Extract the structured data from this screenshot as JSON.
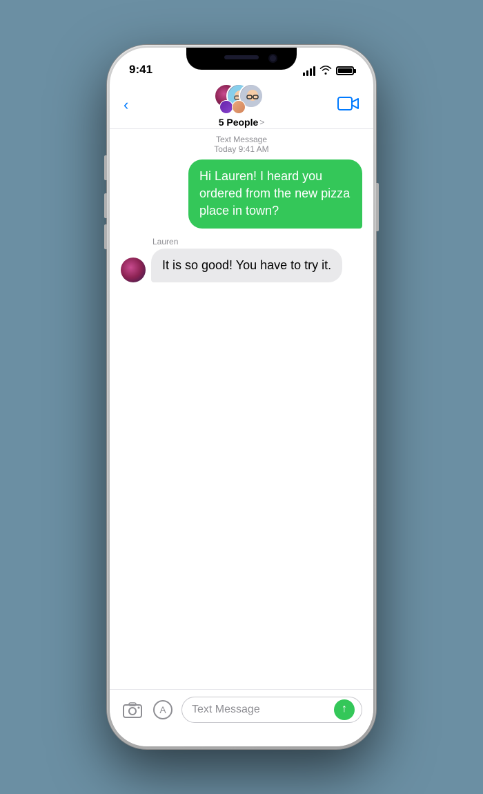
{
  "phone": {
    "status_bar": {
      "time": "9:41",
      "signal_bars": [
        5,
        8,
        11,
        14
      ],
      "wifi": "wifi",
      "battery": "battery"
    },
    "nav": {
      "back_label": "",
      "group_name": "5 People",
      "group_chevron": ">",
      "video_label": "video"
    },
    "messages": [
      {
        "type": "meta",
        "service": "Text Message",
        "time": "Today 9:41 AM"
      },
      {
        "type": "sent",
        "text": "Hi Lauren! I heard you ordered from the new pizza place in town?"
      },
      {
        "type": "received",
        "sender": "Lauren",
        "text": "It is so good! You have to try it."
      }
    ],
    "input": {
      "placeholder": "Text Message",
      "camera_label": "camera",
      "apps_label": "apps",
      "send_label": "send"
    }
  }
}
